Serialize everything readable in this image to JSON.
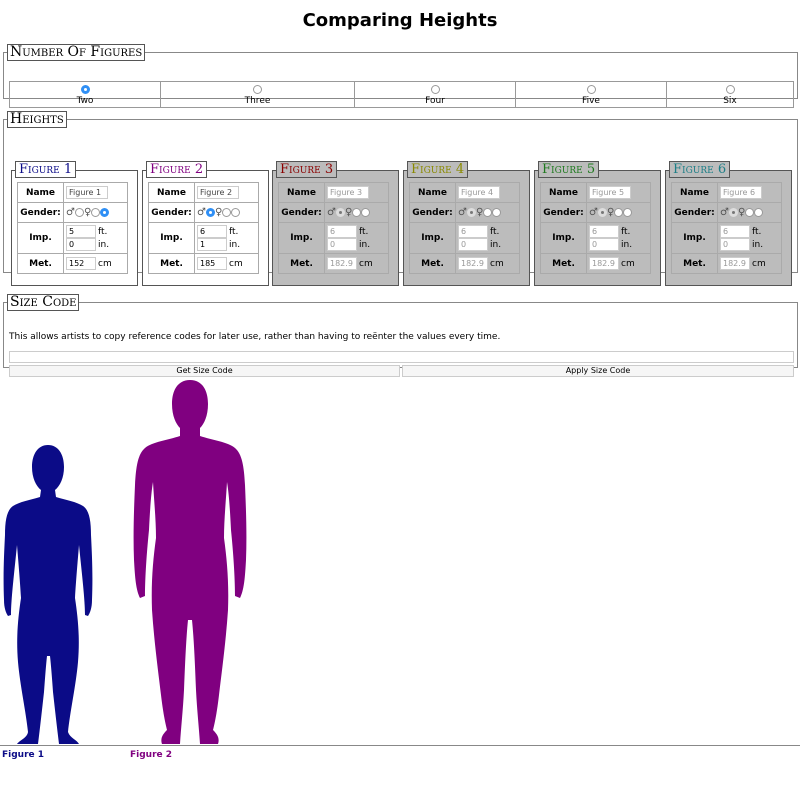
{
  "page_title": "Comparing Heights",
  "count_section": {
    "legend": "Number Of Figures",
    "options": [
      "Two",
      "Three",
      "Four",
      "Five",
      "Six"
    ],
    "selected": "Two"
  },
  "heights_section": {
    "legend": "Heights",
    "row_labels": {
      "name": "Name",
      "gender": "Gender:",
      "imperial": "Imp.",
      "metric": "Met."
    },
    "units": {
      "feet": "ft.",
      "inches": "in.",
      "cm": "cm"
    },
    "gender_symbols": {
      "male": "♂",
      "female": "♀"
    },
    "figures": [
      {
        "title": "Figure 1",
        "name": "Figure 1",
        "gender": "other",
        "feet": "5",
        "inches": "0",
        "cm": "152",
        "color": "#0b0b87",
        "active": true
      },
      {
        "title": "Figure 2",
        "name": "Figure 2",
        "gender": "male",
        "feet": "6",
        "inches": "1",
        "cm": "185",
        "color": "#800080",
        "active": true
      },
      {
        "title": "Figure 3",
        "name": "Figure 3",
        "gender": "male",
        "feet": "6",
        "inches": "0",
        "cm": "182.9",
        "color": "#8b0000",
        "active": false
      },
      {
        "title": "Figure 4",
        "name": "Figure 4",
        "gender": "male",
        "feet": "6",
        "inches": "0",
        "cm": "182.9",
        "color": "#8a8a00",
        "active": false
      },
      {
        "title": "Figure 5",
        "name": "Figure 5",
        "gender": "male",
        "feet": "6",
        "inches": "0",
        "cm": "182.9",
        "color": "#1e7a1e",
        "active": false
      },
      {
        "title": "Figure 6",
        "name": "Figure 6",
        "gender": "male",
        "feet": "6",
        "inches": "0",
        "cm": "182.9",
        "color": "#1d7f87",
        "active": false
      }
    ]
  },
  "size_section": {
    "legend": "Size Code",
    "description": "This allows artists to copy reference codes for later use, rather than having to reënter the values every time.",
    "code_value": "",
    "get_label": "Get Size Code",
    "apply_label": "Apply Size Code"
  },
  "display": {
    "figures": [
      {
        "label": "Figure 1",
        "color": "#0b0b87",
        "height_cm": 152,
        "body": "female-silhouette"
      },
      {
        "label": "Figure 2",
        "color": "#800080",
        "height_cm": 185,
        "body": "male-silhouette"
      }
    ]
  }
}
